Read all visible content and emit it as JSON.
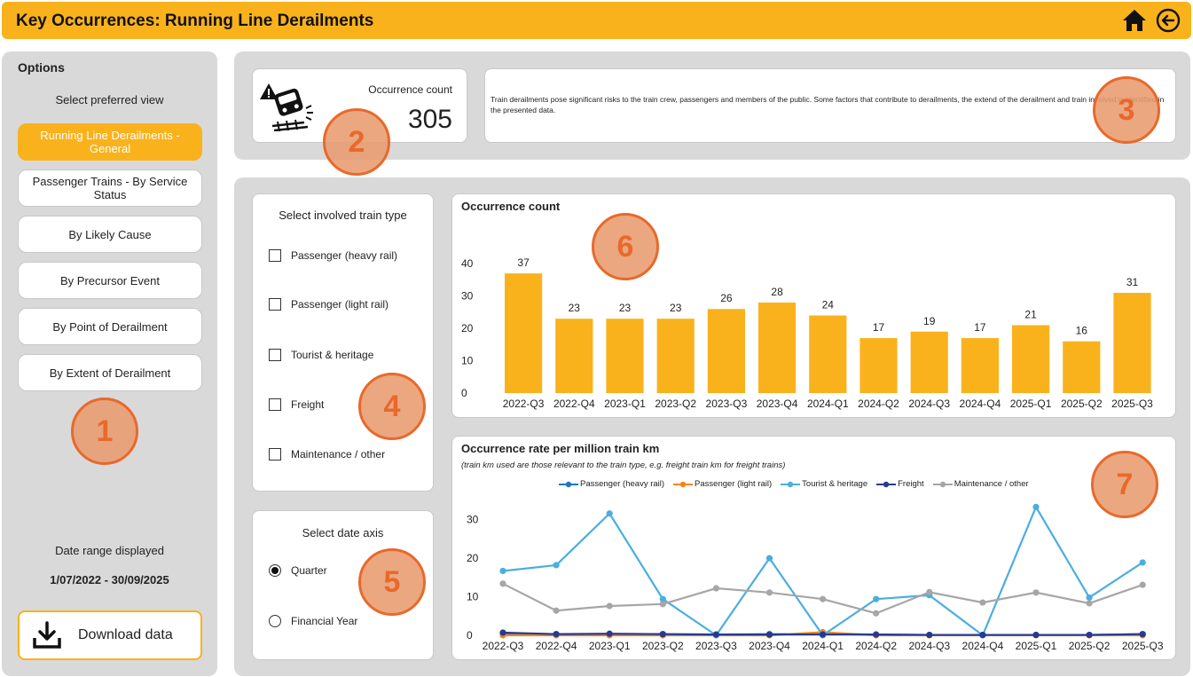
{
  "header": {
    "title": "Key Occurrences: Running Line Derailments"
  },
  "sidebar": {
    "options_title": "Options",
    "view_label": "Select preferred view",
    "items": [
      {
        "label": "Running Line Derailments - General",
        "active": true
      },
      {
        "label": "Passenger Trains - By Service Status",
        "active": false
      },
      {
        "label": "By Likely Cause",
        "active": false
      },
      {
        "label": "By Precursor Event",
        "active": false
      },
      {
        "label": "By Point of Derailment",
        "active": false
      },
      {
        "label": "By Extent of Derailment",
        "active": false
      }
    ],
    "date_range_label": "Date range displayed",
    "date_range_value": "1/07/2022 - 30/09/2025",
    "download_label": "Download data"
  },
  "summary": {
    "occurrence_label": "Occurrence count",
    "occurrence_value": "305",
    "description": "Train derailments pose significant risks to the train crew, passengers and members of the public. Some factors that contribute to derailments, the extend of the derailment and train involved is identified in the presented data."
  },
  "train_filter": {
    "header": "Select involved train type",
    "options": [
      "Passenger (heavy rail)",
      "Passenger (light rail)",
      "Tourist & heritage",
      "Freight",
      "Maintenance / other"
    ]
  },
  "date_axis": {
    "header": "Select date axis",
    "options": [
      {
        "label": "Quarter",
        "selected": true
      },
      {
        "label": "Financial Year",
        "selected": false
      }
    ]
  },
  "badges": [
    "1",
    "2",
    "3",
    "4",
    "5",
    "6",
    "7"
  ],
  "colors": {
    "accent": "#f9b21c",
    "badge": "#e8692b",
    "heavy_rail": "#1f77c4",
    "light_rail": "#f58518",
    "tourist": "#4aaee0",
    "freight": "#283a8f",
    "maintenance": "#a6a6a6"
  },
  "chart_data": [
    {
      "type": "bar",
      "title": "Occurrence count",
      "categories": [
        "2022-Q3",
        "2022-Q4",
        "2023-Q1",
        "2023-Q2",
        "2023-Q3",
        "2023-Q4",
        "2024-Q1",
        "2024-Q2",
        "2024-Q3",
        "2024-Q4",
        "2025-Q1",
        "2025-Q2",
        "2025-Q3"
      ],
      "values": [
        37,
        23,
        23,
        23,
        26,
        28,
        24,
        17,
        19,
        17,
        21,
        16,
        31
      ],
      "yticks": [
        0,
        10,
        20,
        30,
        40
      ],
      "ylim": [
        0,
        45
      ],
      "color": "#f9b21c"
    },
    {
      "type": "line",
      "title": "Occurrence rate per million train km",
      "subtitle": "(train km used are those relevant to the train type, e.g. freight train km for freight trains)",
      "categories": [
        "2022-Q3",
        "2022-Q4",
        "2023-Q1",
        "2023-Q2",
        "2023-Q3",
        "2023-Q4",
        "2024-Q1",
        "2024-Q2",
        "2024-Q3",
        "2024-Q4",
        "2025-Q1",
        "2025-Q2",
        "2025-Q3"
      ],
      "yticks": [
        0,
        10,
        20,
        30
      ],
      "ylim": [
        0,
        35
      ],
      "legend": "top-center",
      "series": [
        {
          "name": "Passenger (heavy rail)",
          "color": "#1f77c4",
          "values": [
            0.5,
            0.3,
            0.3,
            0.3,
            0.2,
            0.3,
            0.3,
            0.2,
            0.1,
            0.1,
            0.1,
            0.1,
            0.3
          ]
        },
        {
          "name": "Passenger (light rail)",
          "color": "#f58518",
          "values": [
            0,
            0,
            0,
            0,
            0,
            0,
            0.8,
            0,
            0,
            0,
            0,
            0,
            0
          ]
        },
        {
          "name": "Tourist & heritage",
          "color": "#4aaee0",
          "values": [
            16.7,
            18.2,
            31.6,
            9.4,
            0,
            20,
            0,
            9.4,
            10.4,
            0,
            33.3,
            9.8,
            18.9
          ]
        },
        {
          "name": "Freight",
          "color": "#283a8f",
          "values": [
            0.7,
            0.3,
            0.4,
            0.3,
            0.2,
            0.2,
            0.2,
            0.2,
            0.1,
            0.1,
            0.1,
            0.1,
            0.3
          ]
        },
        {
          "name": "Maintenance / other",
          "color": "#a6a6a6",
          "values": [
            13.4,
            6.4,
            7.6,
            8.1,
            12.2,
            11.1,
            9.4,
            5.7,
            11.2,
            8.5,
            11.1,
            8.3,
            13.1
          ]
        }
      ]
    }
  ]
}
